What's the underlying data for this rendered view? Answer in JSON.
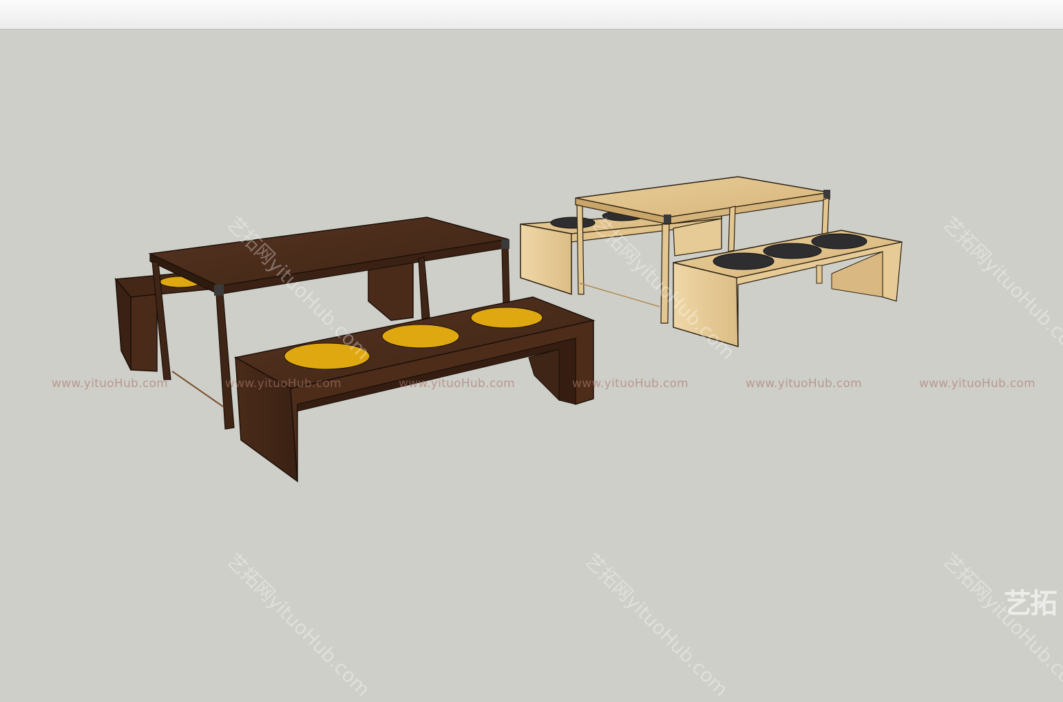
{
  "viewport": {
    "background_color": "#cfcfc9",
    "scene": "Two dining table sets with benches and round seat cushions",
    "objects": [
      {
        "name": "dark-wood-table-set",
        "wood_color": "#4a2c1a",
        "cushion_color": "#e0a810"
      },
      {
        "name": "light-wood-table-set",
        "wood_color": "#e3c690",
        "cushion_color": "#2e2e30"
      }
    ]
  },
  "watermarks": {
    "row_text": [
      "www.yituoHub.com",
      "www.yituoHub.com",
      "www.yituoHub.com",
      "www.yituoHub.com",
      "www.yituoHub.com",
      "www.yituoHub.com"
    ],
    "diagonal_text": [
      "艺拓网yituoHub.com",
      "艺拓网yituoHub.com",
      "艺拓网yituoHub.com",
      "艺拓网yituoHub.com",
      "艺拓网yituoHub.com",
      "艺拓网yituoHub.com"
    ],
    "corner_logo": "艺拓"
  }
}
